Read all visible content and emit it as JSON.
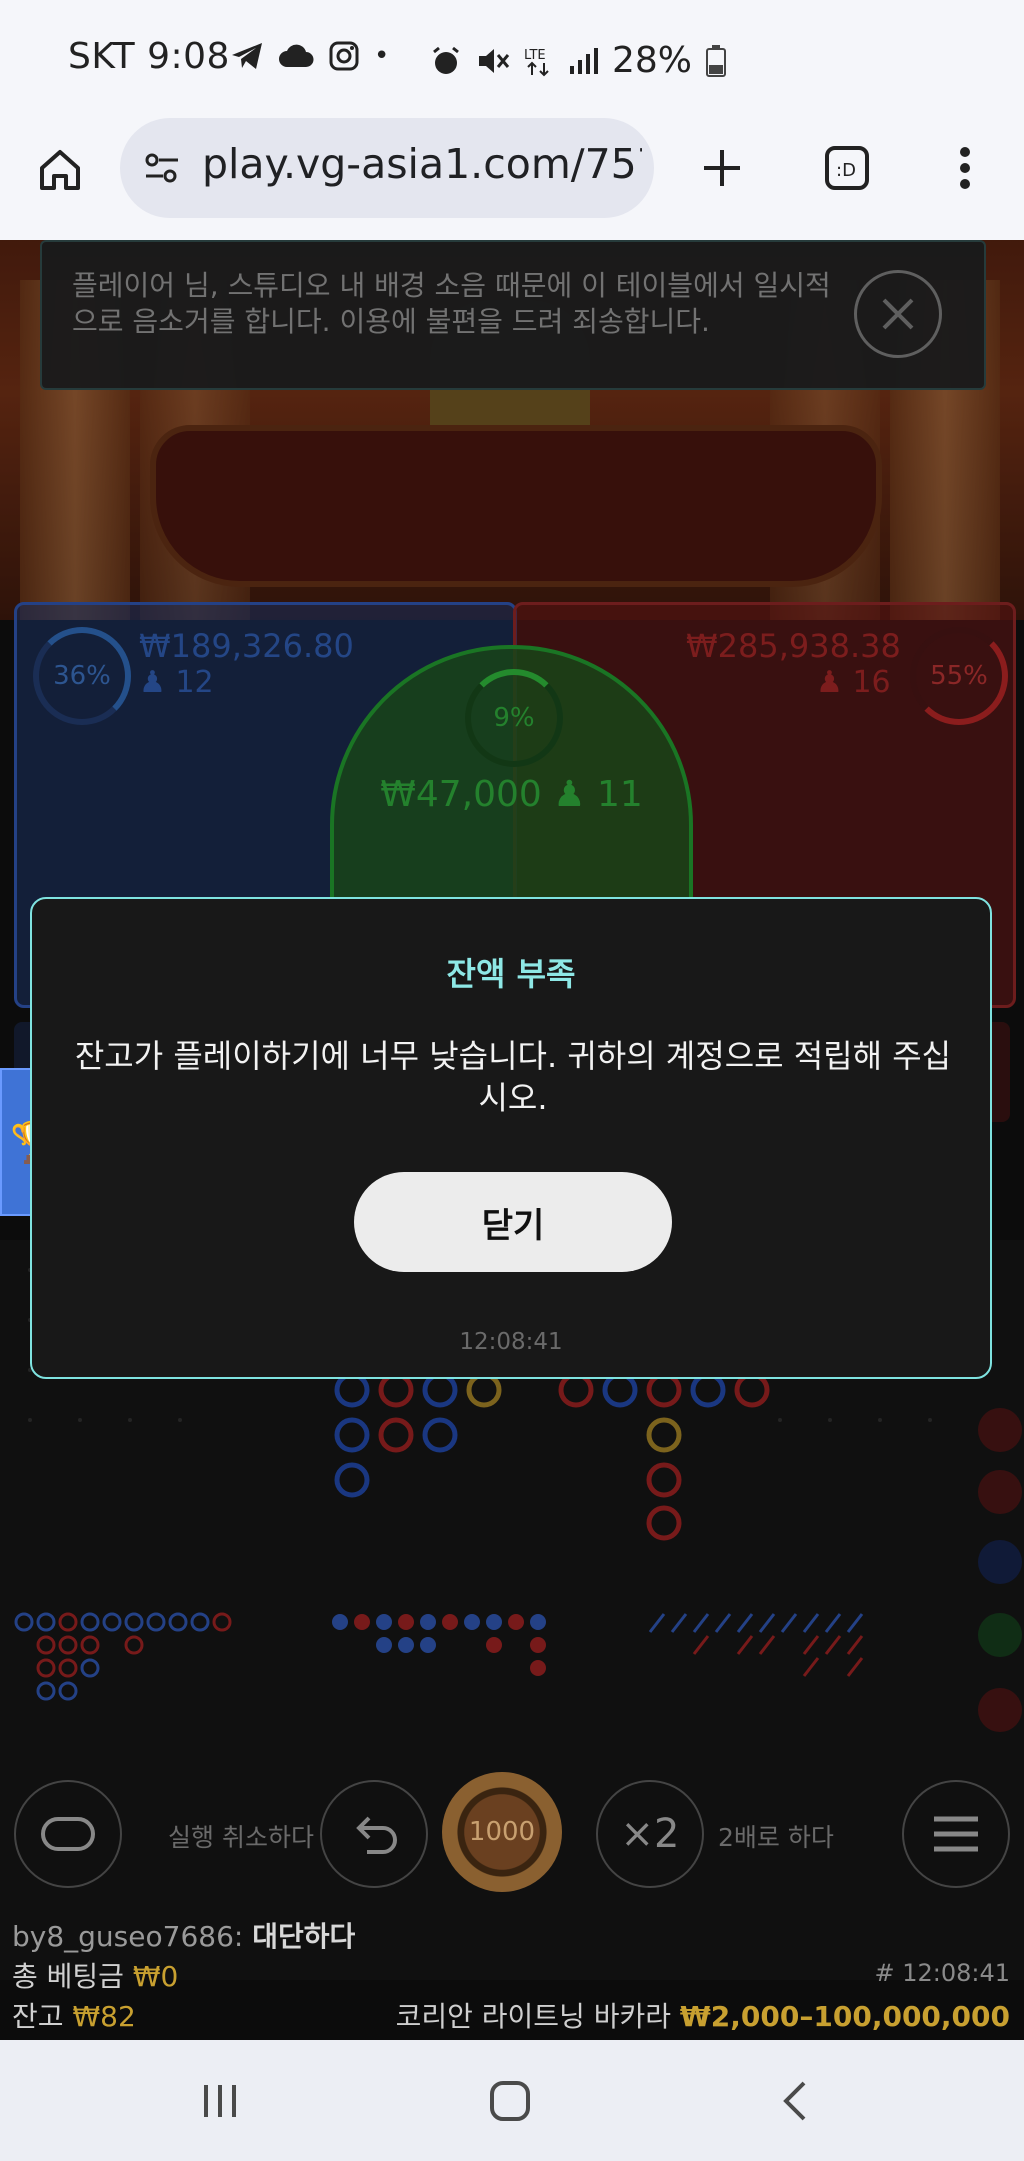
{
  "status_bar": {
    "carrier_time": "SKT 9:08",
    "battery": "28%"
  },
  "browser": {
    "url": "play.vg-asia1.com/757"
  },
  "game": {
    "player_percent": "36%",
    "player_amount": "₩189,326.80",
    "player_count": "12",
    "banker_percent": "55%",
    "banker_amount": "₩285,938.38",
    "banker_count": "16",
    "tie_percent": "9%",
    "tie_amount": "₩47,000",
    "tie_count": "11"
  },
  "notice": {
    "message": "플레이어 님, 스튜디오 내 배경 소음 때문에 이 테이블에서 일시적으로 음소거를 합니다. 이용에 불편을 드려 죄송합니다."
  },
  "modal": {
    "title": "잔액 부족",
    "body": "잔고가 플레이하기에 너무 낮습니다. 귀하의 계정으로 적립해 주십시오.",
    "close_label": "닫기",
    "time": "12:08:41"
  },
  "controls": {
    "undo_label": "실행 취소하다",
    "chip_value": "1000",
    "double_symbol": "×2",
    "double_label": "2배로 하다"
  },
  "footer": {
    "chat_user": "by8_guseo7686:",
    "chat_message": "대단하다",
    "total_bet_label": "총 베팅금",
    "total_bet_value": "₩0",
    "balance_label": "잔고",
    "balance_value": "₩82",
    "round_id": "# 12:08:41",
    "table_name": "코리안 라이트닝 바카라",
    "table_limits": "₩2,000–100,000,000"
  }
}
